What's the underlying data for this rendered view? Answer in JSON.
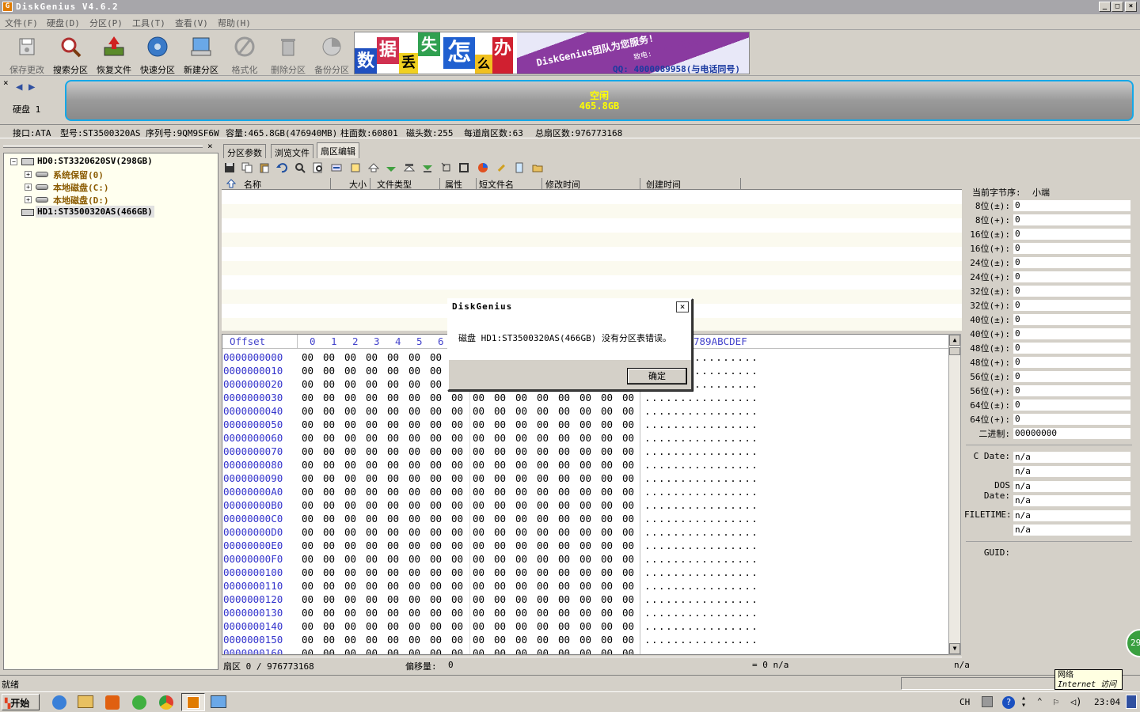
{
  "window": {
    "title": "DiskGenius V4.6.2",
    "icon": "diskgenius-icon",
    "btn_min": "_",
    "btn_max": "□",
    "btn_close": "×"
  },
  "menu": [
    "文件(F)",
    "硬盘(D)",
    "分区(P)",
    "工具(T)",
    "查看(V)",
    "帮助(H)"
  ],
  "toolbar": [
    {
      "label": "保存更改",
      "icon": "save-disk-icon",
      "enabled": false
    },
    {
      "label": "搜索分区",
      "icon": "search-partition-icon",
      "enabled": true
    },
    {
      "label": "恢复文件",
      "icon": "recover-files-icon",
      "enabled": true
    },
    {
      "label": "快速分区",
      "icon": "quick-partition-icon",
      "enabled": true
    },
    {
      "label": "新建分区",
      "icon": "new-partition-icon",
      "enabled": true
    },
    {
      "label": "格式化",
      "icon": "format-icon",
      "enabled": false
    },
    {
      "label": "删除分区",
      "icon": "delete-partition-icon",
      "enabled": false
    },
    {
      "label": "备份分区",
      "icon": "backup-partition-icon",
      "enabled": false
    }
  ],
  "banner": {
    "chars": [
      "数",
      "据",
      "丢",
      "失",
      "怎",
      "么",
      "办"
    ],
    "slogan": "DiskGenius团队为您服务!",
    "phone": "400-008-9958",
    "phone_label": "致电:",
    "qq": "QQ: 4000089958(与电话同号)"
  },
  "disk_nav": {
    "label": "硬盘 1",
    "segment_label": "空闲",
    "segment_size": "465.8GB"
  },
  "disk_info": {
    "interface": "接口:ATA",
    "model": "型号:ST3500320AS",
    "serial": "序列号:9QM9SF6W",
    "capacity": "容量:465.8GB(476940MB)",
    "cylinders": "柱面数:60801",
    "heads": "磁头数:255",
    "sectors_per_track": "每道扇区数:63",
    "total_sectors": "总扇区数:976773168"
  },
  "tree": [
    {
      "label": "HD0:ST3320620SV(298GB)",
      "type": "disk",
      "expand": "−"
    },
    {
      "label": "系统保留(0)",
      "type": "partition",
      "expand": "+"
    },
    {
      "label": "本地磁盘(C:)",
      "type": "partition",
      "expand": "+"
    },
    {
      "label": "本地磁盘(D:)",
      "type": "partition",
      "expand": "+"
    },
    {
      "label": "HD1:ST3500320AS(466GB)",
      "type": "disk",
      "expand": ""
    }
  ],
  "tabs": [
    "分区参数",
    "浏览文件",
    "扇区编辑"
  ],
  "active_tab": 2,
  "file_columns": [
    "名称",
    "大小",
    "文件类型",
    "属性",
    "短文件名",
    "修改时间",
    "创建时间"
  ],
  "hex": {
    "header_offset": "Offset",
    "header_cols": [
      "0",
      "1",
      "2",
      "3",
      "4",
      "5",
      "6"
    ],
    "header_ascii": "789ABCDEF",
    "offsets": [
      "0000000000",
      "0000000010",
      "0000000020",
      "0000000030",
      "0000000040",
      "0000000050",
      "0000000060",
      "0000000070",
      "0000000080",
      "0000000090",
      "00000000A0",
      "00000000B0",
      "00000000C0",
      "00000000D0",
      "00000000E0",
      "00000000F0",
      "0000000100",
      "0000000110",
      "0000000120",
      "0000000130",
      "0000000140",
      "0000000150",
      "0000000160"
    ],
    "byte": "00",
    "ascii": "................"
  },
  "statusline": {
    "sector": "扇区 0 / 976773168",
    "offset_label": "偏移量:",
    "offset_value": "0",
    "eq": "= 0 n/a",
    "na": "n/a"
  },
  "inspector": {
    "byte_order_label": "当前字节序:",
    "byte_order": "小端",
    "fields": [
      {
        "label": "8位(±):",
        "value": "0"
      },
      {
        "label": "8位(+):",
        "value": "0"
      },
      {
        "label": "16位(±):",
        "value": "0"
      },
      {
        "label": "16位(+):",
        "value": "0"
      },
      {
        "label": "24位(±):",
        "value": "0"
      },
      {
        "label": "24位(+):",
        "value": "0"
      },
      {
        "label": "32位(±):",
        "value": "0"
      },
      {
        "label": "32位(+):",
        "value": "0"
      },
      {
        "label": "40位(±):",
        "value": "0"
      },
      {
        "label": "40位(+):",
        "value": "0"
      },
      {
        "label": "48位(±):",
        "value": "0"
      },
      {
        "label": "48位(+):",
        "value": "0"
      },
      {
        "label": "56位(±):",
        "value": "0"
      },
      {
        "label": "56位(+):",
        "value": "0"
      },
      {
        "label": "64位(±):",
        "value": "0"
      },
      {
        "label": "64位(+):",
        "value": "0"
      },
      {
        "label": "二进制:",
        "value": "00000000"
      }
    ],
    "dates": [
      {
        "label": "C Date:",
        "value": "n/a"
      },
      {
        "label": "",
        "value": "n/a"
      },
      {
        "label": "DOS Date:",
        "value": "n/a"
      },
      {
        "label": "",
        "value": "n/a"
      },
      {
        "label": "FILETIME:",
        "value": "n/a"
      },
      {
        "label": "",
        "value": "n/a"
      }
    ],
    "guid_label": "GUID:"
  },
  "app_status": "就绪",
  "badge": "29",
  "dialog": {
    "title": "DiskGenius",
    "message": "磁盘 HD1:ST3500320AS(466GB) 没有分区表错误。",
    "ok": "确定"
  },
  "taskbar": {
    "start": "开始",
    "lang": "CH",
    "time": "23:04",
    "tooltip_line1": "网络",
    "tooltip_line2": "Internet 访问"
  }
}
